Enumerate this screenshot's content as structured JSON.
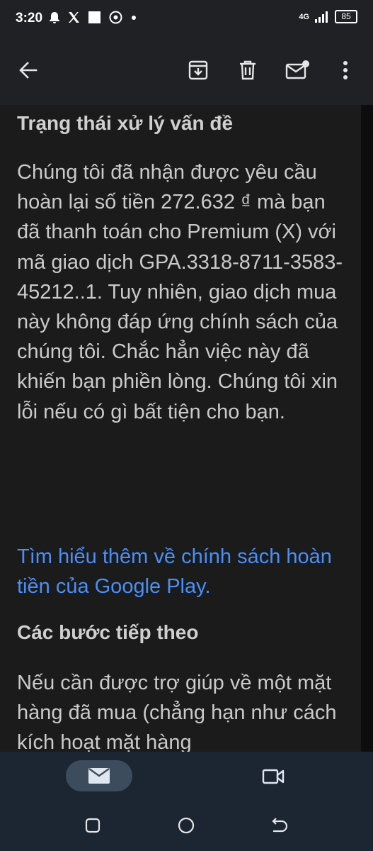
{
  "status": {
    "time": "3:20",
    "network": "4G",
    "battery": "85"
  },
  "app_bar": {
    "back_label": "Back",
    "actions": [
      "archive",
      "delete",
      "mark-unread",
      "more"
    ]
  },
  "email": {
    "section1_title": "Trạng thái xử lý vấn đề",
    "section1_body": "Chúng tôi đã nhận được yêu cầu hoàn lại số tiền 272.632 ₫ mà bạn đã thanh toán cho Premium (X) với mã giao dịch GPA.3318-8711-3583-45212..1. Tuy nhiên, giao dịch mua này không đáp ứng chính sách của chúng tôi. Chắc hẳn việc này đã khiến bạn phiền lòng. Chúng tôi xin lỗi nếu có gì bất tiện cho bạn.",
    "link_text": "Tìm hiểu thêm về chính sách hoàn tiền của Google Play.",
    "section2_title": "Các bước tiếp theo",
    "section2_body": "Nếu cần được trợ giúp về một mặt hàng đã mua (chẳng hạn như cách kích hoạt mặt hàng"
  },
  "colors": {
    "link": "#4a8ff7",
    "nav_background": "#1c2532",
    "nav_pill": "#3d4c5d"
  }
}
